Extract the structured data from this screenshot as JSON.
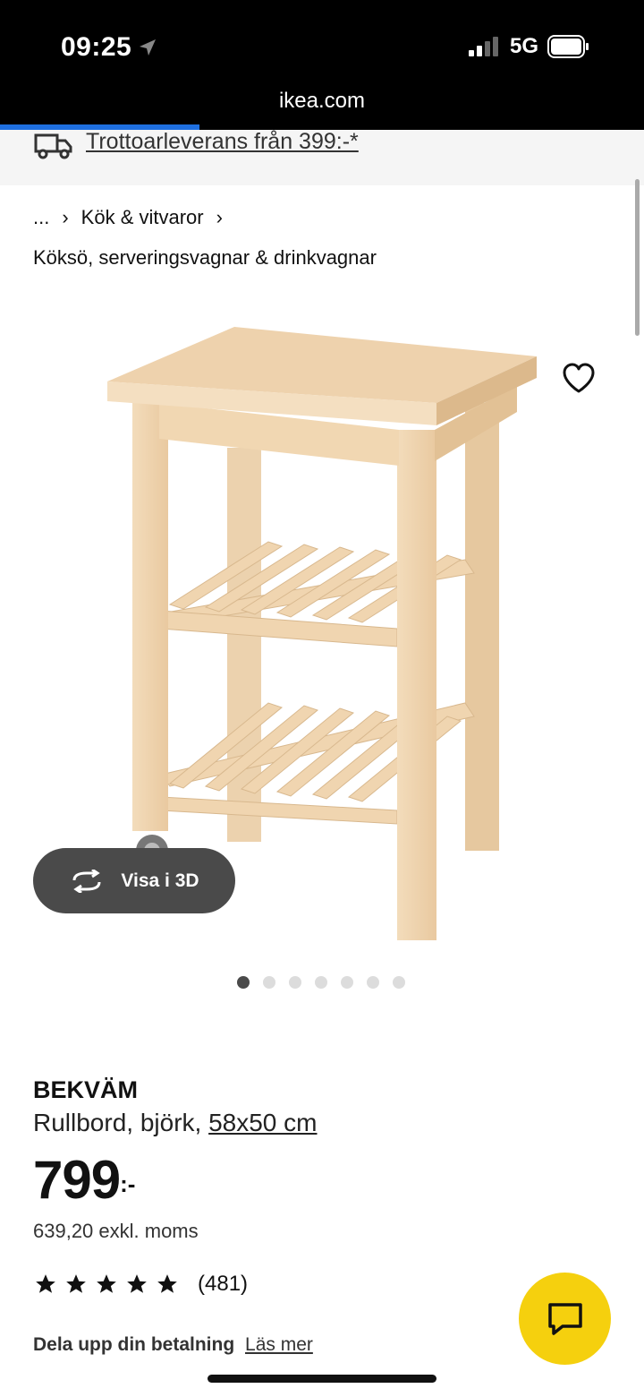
{
  "status_bar": {
    "time": "09:25",
    "network": "5G",
    "url": "ikea.com",
    "load_progress": 0.31
  },
  "delivery": {
    "text": "Trottoarleverans från 399:-*",
    "icon": "truck-icon"
  },
  "breadcrumb": {
    "ellipsis": "...",
    "parent": "Kök & vitvaror",
    "current": "Köksö, serveringsvagnar & drinkvagnar"
  },
  "gallery": {
    "view_3d_label": "Visa i 3D",
    "image_count": 7,
    "active_index": 0
  },
  "product": {
    "brand": "BEKVÄM",
    "description": "Rullbord, björk,",
    "size": "58x50 cm",
    "price": "799",
    "price_suffix": ":-",
    "price_ex_vat": "639,20 exkl. moms",
    "rating": 5,
    "review_count": "(481)",
    "installment_text": "Dela upp din betalning",
    "installment_link": "Läs mer"
  },
  "colors": {
    "accent_blue": "#1e6fe0",
    "chat_yellow": "#f5d00e",
    "wood": "#eed2ad"
  }
}
